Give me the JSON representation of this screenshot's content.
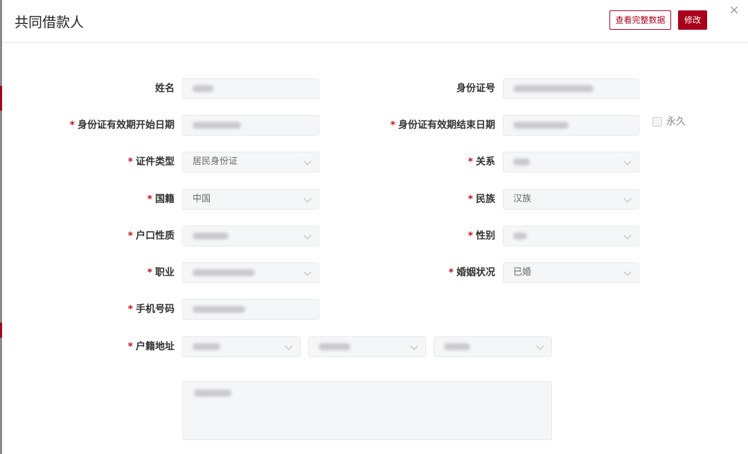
{
  "header": {
    "title": "共同借款人",
    "view_full_label": "查看完整数据",
    "edit_label": "修改",
    "close_glyph": "×"
  },
  "required_mark": "*",
  "form": {
    "name": {
      "label": "姓名",
      "value": ""
    },
    "id_number": {
      "label": "身份证号",
      "value": ""
    },
    "id_start_date": {
      "label": "身份证有效期开始日期",
      "value": ""
    },
    "id_end_date": {
      "label": "身份证有效期结束日期",
      "value": ""
    },
    "permanent": {
      "label": "永久",
      "checked": false
    },
    "id_type": {
      "label": "证件类型",
      "value": "居民身份证"
    },
    "relation": {
      "label": "关系",
      "value": ""
    },
    "nationality": {
      "label": "国籍",
      "value": "中国"
    },
    "ethnicity": {
      "label": "民族",
      "value": "汉族"
    },
    "household_type": {
      "label": "户口性质",
      "value": ""
    },
    "gender": {
      "label": "性别",
      "value": ""
    },
    "occupation": {
      "label": "职业",
      "value": ""
    },
    "marital_status": {
      "label": "婚姻状况",
      "value": "已婚"
    },
    "phone": {
      "label": "手机号码",
      "value": ""
    },
    "address": {
      "label": "户籍地址",
      "province": "",
      "city": "",
      "district": "",
      "detail": ""
    }
  },
  "colors": {
    "accent": "#a8001a",
    "required": "#c0121f",
    "field_bg": "#f5f6f8"
  }
}
